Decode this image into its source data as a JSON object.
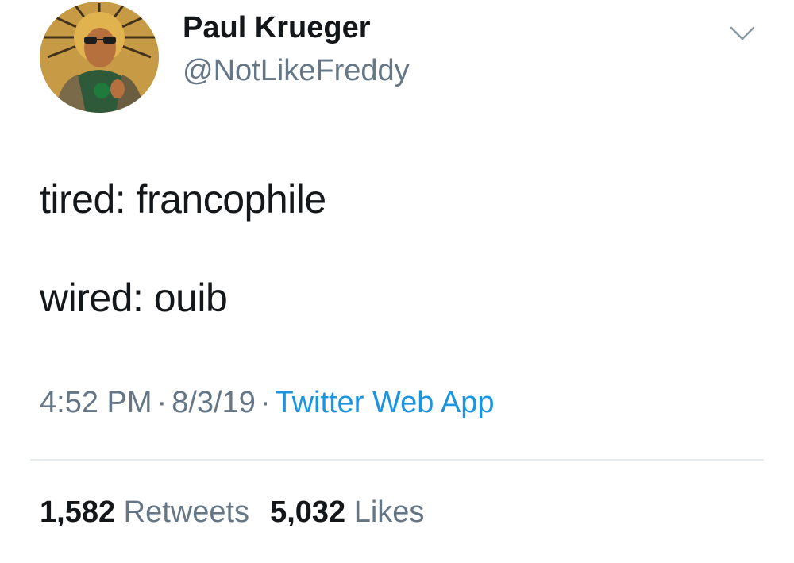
{
  "user": {
    "display_name": "Paul Krueger",
    "handle": "@NotLikeFreddy",
    "avatar": "profile-photo"
  },
  "menu": {
    "icon": "chevron-down-icon"
  },
  "tweet": {
    "lines": [
      "tired: francophile",
      "wired: ouib"
    ]
  },
  "meta": {
    "time": "4:52 PM",
    "separator": "·",
    "date": "8/3/19",
    "source": "Twitter Web App"
  },
  "stats": {
    "retweets_count": "1,582",
    "retweets_label": "Retweets",
    "likes_count": "5,032",
    "likes_label": "Likes"
  },
  "colors": {
    "text": "#14171a",
    "secondary": "#657786",
    "link": "#1b95e0",
    "divider": "#e6ecf0"
  }
}
